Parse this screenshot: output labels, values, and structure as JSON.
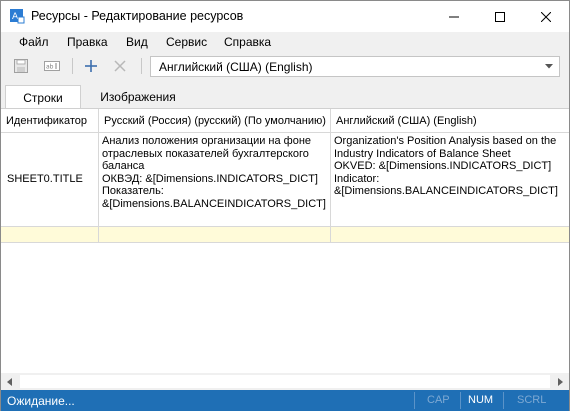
{
  "window": {
    "title": "Ресурсы - Редактирование ресурсов"
  },
  "menu": [
    "Файл",
    "Правка",
    "Вид",
    "Сервис",
    "Справка"
  ],
  "toolbar": {
    "icons": [
      "save-icon",
      "rename-icon",
      "add-icon",
      "delete-icon"
    ],
    "language_value": "Английский (США) (English)"
  },
  "tabs": [
    {
      "label": "Строки",
      "active": true
    },
    {
      "label": "Изображения",
      "active": false
    }
  ],
  "grid": {
    "columns": [
      "Идентификатор",
      "Русский (Россия) (русский) (По умолчанию)",
      "Английский (США) (English)"
    ],
    "rows": [
      {
        "id": "SHEET0.TITLE",
        "ru": [
          "Анализ положения организации на фоне",
          "отраслевых показателей бухгалтерского",
          "баланса",
          "ОКВЭД: &[Dimensions.INDICATORS_DICT]",
          "Показатель:",
          "&[Dimensions.BALANCEINDICATORS_DICT]"
        ],
        "en": [
          "Organization's Position Analysis based on the",
          "Industry Indicators of Balance Sheet",
          "OKVED: &[Dimensions.INDICATORS_DICT]",
          "Indicator:",
          "&[Dimensions.BALANCEINDICATORS_DICT]"
        ]
      }
    ]
  },
  "status": {
    "text": "Ожидание...",
    "indicators": [
      {
        "label": "CAP",
        "active": false
      },
      {
        "label": "NUM",
        "active": true
      },
      {
        "label": "SCRL",
        "active": false
      }
    ]
  },
  "colors": {
    "statusbar": "#1f6fb5",
    "new_row": "#fffbd9",
    "accent_blue": "#1e73c8"
  }
}
